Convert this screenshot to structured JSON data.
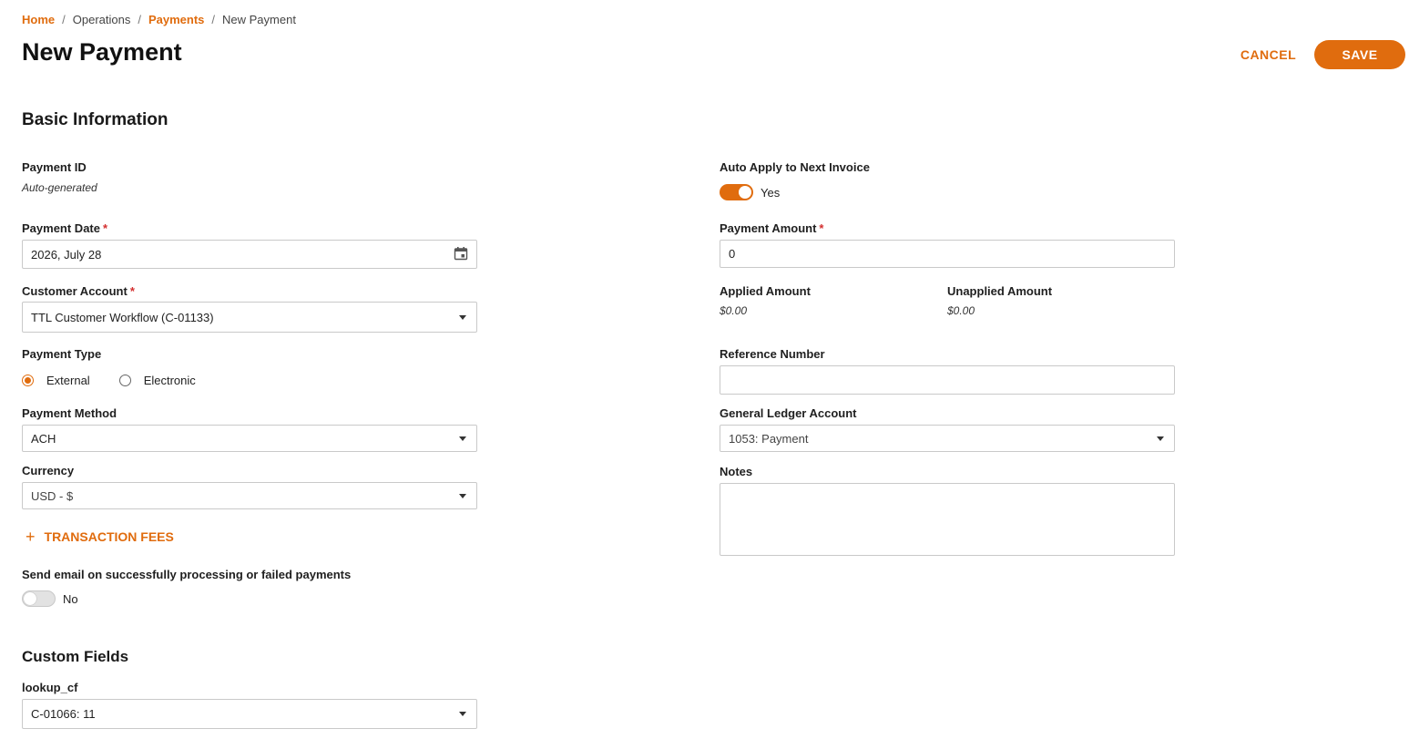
{
  "breadcrumb": {
    "home": "Home",
    "operations": "Operations",
    "payments": "Payments",
    "current": "New Payment",
    "separator": "/"
  },
  "header": {
    "title": "New Payment",
    "cancel_label": "CANCEL",
    "save_label": "SAVE"
  },
  "sections": {
    "basic": "Basic Information",
    "custom": "Custom Fields"
  },
  "form": {
    "payment_id": {
      "label": "Payment ID",
      "value": "Auto-generated"
    },
    "payment_date": {
      "label": "Payment Date",
      "value": "2026, July 28"
    },
    "customer_account": {
      "label": "Customer Account",
      "value": "TTL Customer Workflow (C-01133)"
    },
    "payment_type": {
      "label": "Payment Type",
      "options": [
        "External",
        "Electronic"
      ],
      "selected": "External"
    },
    "payment_method": {
      "label": "Payment Method",
      "value": "ACH"
    },
    "currency": {
      "label": "Currency",
      "value": "USD - $"
    },
    "transaction_fees": {
      "label": "TRANSACTION FEES",
      "icon": "plus-icon"
    },
    "send_email": {
      "label": "Send email on successfully processing or failed payments",
      "state_text": "No",
      "on": false
    },
    "auto_apply": {
      "label": "Auto Apply to Next Invoice",
      "state_text": "Yes",
      "on": true
    },
    "payment_amount": {
      "label": "Payment Amount",
      "value": "0"
    },
    "applied_amount": {
      "label": "Applied Amount",
      "value": "$0.00"
    },
    "unapplied_amount": {
      "label": "Unapplied Amount",
      "value": "$0.00"
    },
    "reference_number": {
      "label": "Reference Number",
      "value": ""
    },
    "gl_account": {
      "label": "General Ledger Account",
      "value": "1053: Payment"
    },
    "notes": {
      "label": "Notes",
      "value": ""
    }
  },
  "custom_fields": {
    "lookup_cf": {
      "label": "lookup_cf",
      "value": "C-01066: 11"
    }
  },
  "required_marker": "*",
  "colors": {
    "accent": "#e06c0e",
    "required": "#d32f2f",
    "border": "#c9c9c9"
  }
}
